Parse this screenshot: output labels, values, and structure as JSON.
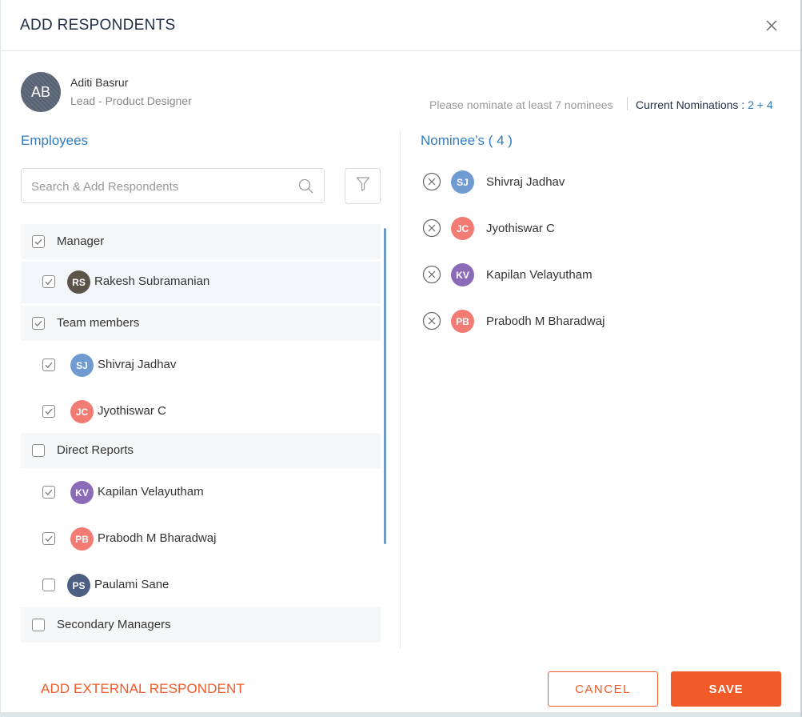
{
  "modal": {
    "title": "ADD RESPONDENTS",
    "close_icon": "close-icon"
  },
  "user": {
    "initials": "AB",
    "name": "Aditi Basrur",
    "role": "Lead - Product Designer"
  },
  "nomination": {
    "note": "Please nominate at least 7 nominees",
    "current_label": "Current Nominations : ",
    "current_value": "2",
    "current_added": "+ 4"
  },
  "employees": {
    "title": "Employees",
    "search_placeholder": "Search & Add Respondents",
    "search_icon": "search-icon",
    "filter_icon": "filter-icon",
    "groups": [
      {
        "label": "Manager",
        "checked": true,
        "members": [
          {
            "initials": "RS",
            "name": "Rakesh Subramanian",
            "checked": true,
            "color": "#5d5449",
            "highlight": true
          }
        ]
      },
      {
        "label": "Team members",
        "checked": true,
        "members": [
          {
            "initials": "SJ",
            "name": "Shivraj Jadhav",
            "checked": true,
            "color": "#6f9bd1",
            "highlight": false
          },
          {
            "initials": "JC",
            "name": "Jyothiswar C",
            "checked": true,
            "color": "#f27b74",
            "highlight": false
          }
        ]
      },
      {
        "label": "Direct Reports",
        "checked": false,
        "members": [
          {
            "initials": "KV",
            "name": "Kapilan Velayutham",
            "checked": true,
            "color": "#8b6bb8",
            "highlight": false
          },
          {
            "initials": "PB",
            "name": "Prabodh M Bharadwaj",
            "checked": true,
            "color": "#f27b74",
            "highlight": false
          },
          {
            "initials": "PS",
            "name": "Paulami Sane",
            "checked": false,
            "color": "#4c5e82",
            "highlight": false
          }
        ]
      },
      {
        "label": "Secondary Managers",
        "checked": false,
        "members": []
      }
    ]
  },
  "nominees": {
    "title": "Nominee’s ( 4 )",
    "remove_icon": "remove-circle-icon",
    "items": [
      {
        "initials": "SJ",
        "name": "Shivraj Jadhav",
        "color": "#6f9bd1"
      },
      {
        "initials": "JC",
        "name": "Jyothiswar C",
        "color": "#f27b74"
      },
      {
        "initials": "KV",
        "name": "Kapilan Velayutham",
        "color": "#8b6bb8"
      },
      {
        "initials": "PB",
        "name": "Prabodh M Bharadwaj",
        "color": "#f27b74"
      }
    ]
  },
  "footer": {
    "add_external": "ADD EXTERNAL RESPONDENT",
    "cancel": "CANCEL",
    "save": "SAVE"
  },
  "colors": {
    "accent_blue": "#2f7cc3",
    "accent_orange": "#f05a28"
  }
}
